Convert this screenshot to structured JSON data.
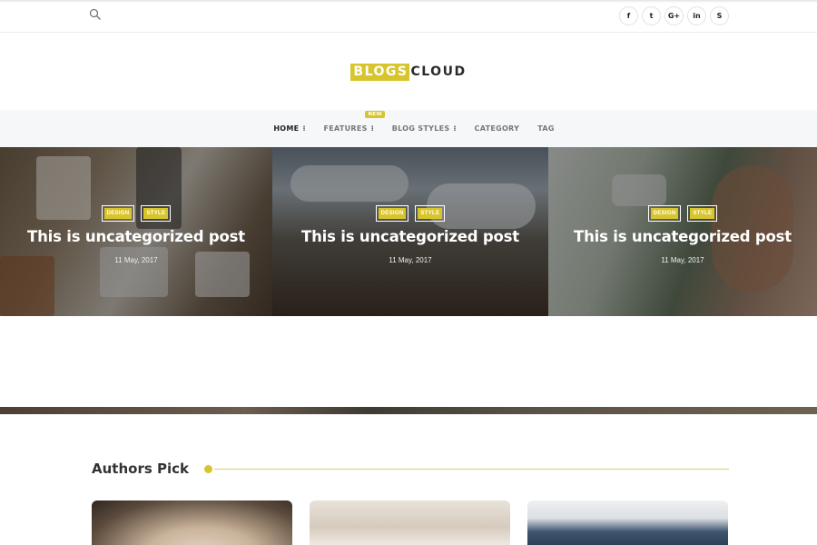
{
  "header": {
    "search_icon": "search-icon",
    "social_icons": [
      {
        "name": "facebook-icon",
        "glyph": "f"
      },
      {
        "name": "twitter-icon",
        "glyph": "t"
      },
      {
        "name": "google-plus-icon",
        "glyph": "G+"
      },
      {
        "name": "linkedin-icon",
        "glyph": "in"
      },
      {
        "name": "skype-icon",
        "glyph": "S"
      }
    ]
  },
  "logo": {
    "part_a": "BLOGS",
    "part_b": "CLOUD"
  },
  "nav": {
    "items": [
      {
        "label": "HOME",
        "has_menu": true,
        "active": true
      },
      {
        "label": "FEATURES",
        "has_menu": true,
        "badge": "NEW"
      },
      {
        "label": "BLOG STYLES",
        "has_menu": true
      },
      {
        "label": "CATEGORY"
      },
      {
        "label": "TAG"
      }
    ]
  },
  "slides": [
    {
      "tags": [
        "DESIGN",
        "STYLE"
      ],
      "title": "This is uncategorized post",
      "date": "11 May, 2017"
    },
    {
      "tags": [
        "DESIGN",
        "STYLE"
      ],
      "title": "This is uncategorized post",
      "date": "11 May, 2017"
    },
    {
      "tags": [
        "DESIGN",
        "STYLE"
      ],
      "title": "This is uncategorized post",
      "date": "11 May, 2017"
    }
  ],
  "authors_pick": {
    "title": "Authors Pick"
  },
  "colors": {
    "accent": "#d8c52b",
    "nav_bg": "#f6f7f9"
  }
}
